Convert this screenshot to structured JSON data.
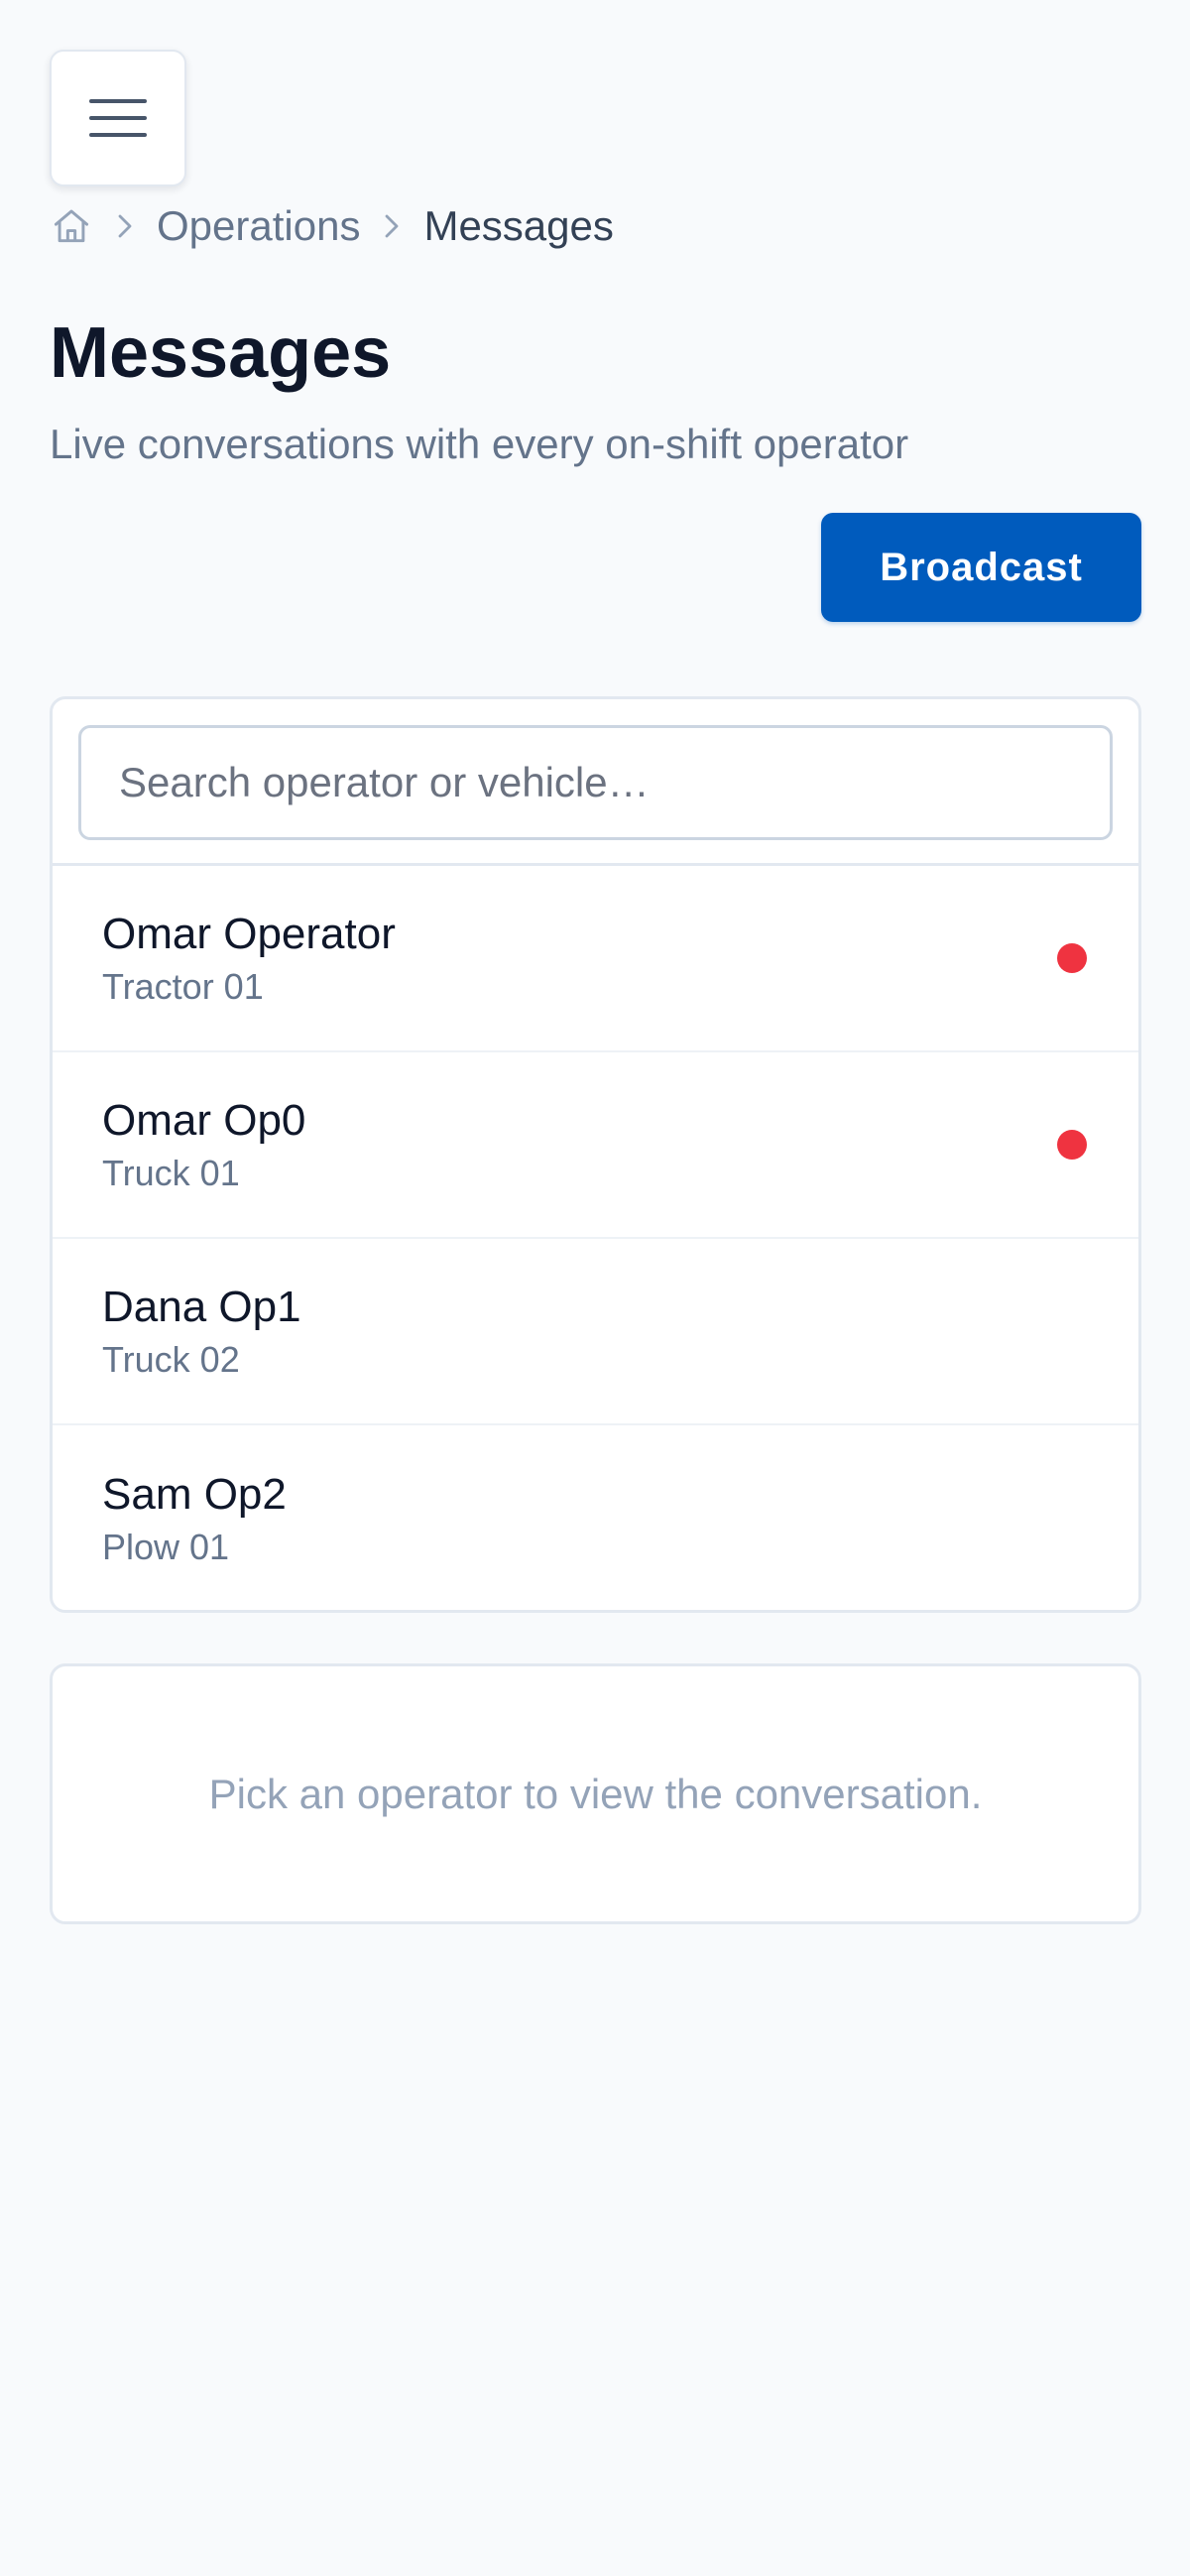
{
  "header": {
    "menu_icon": "hamburger-menu-icon"
  },
  "breadcrumb": {
    "home_icon": "home-icon",
    "separator_icon": "chevron-right-icon",
    "items": [
      "Operations",
      "Messages"
    ]
  },
  "page": {
    "title": "Messages",
    "subtitle": "Live conversations with every on-shift operator"
  },
  "actions": {
    "broadcast_label": "Broadcast"
  },
  "search": {
    "placeholder": "Search operator or vehicle…",
    "value": ""
  },
  "operators": [
    {
      "name": "Omar Operator",
      "vehicle": "Tractor 01",
      "unread": true
    },
    {
      "name": "Omar Op0",
      "vehicle": "Truck 01",
      "unread": true
    },
    {
      "name": "Dana Op1",
      "vehicle": "Truck 02",
      "unread": false
    },
    {
      "name": "Sam Op2",
      "vehicle": "Plow 01",
      "unread": false
    }
  ],
  "conversation": {
    "empty_text": "Pick an operator to view the conversation."
  },
  "colors": {
    "background": "#f8fafc",
    "accent": "#005bbd",
    "unread": "#ef3340",
    "text_primary": "#0f172a",
    "text_secondary": "#64748b",
    "border": "#e2e8f0"
  }
}
